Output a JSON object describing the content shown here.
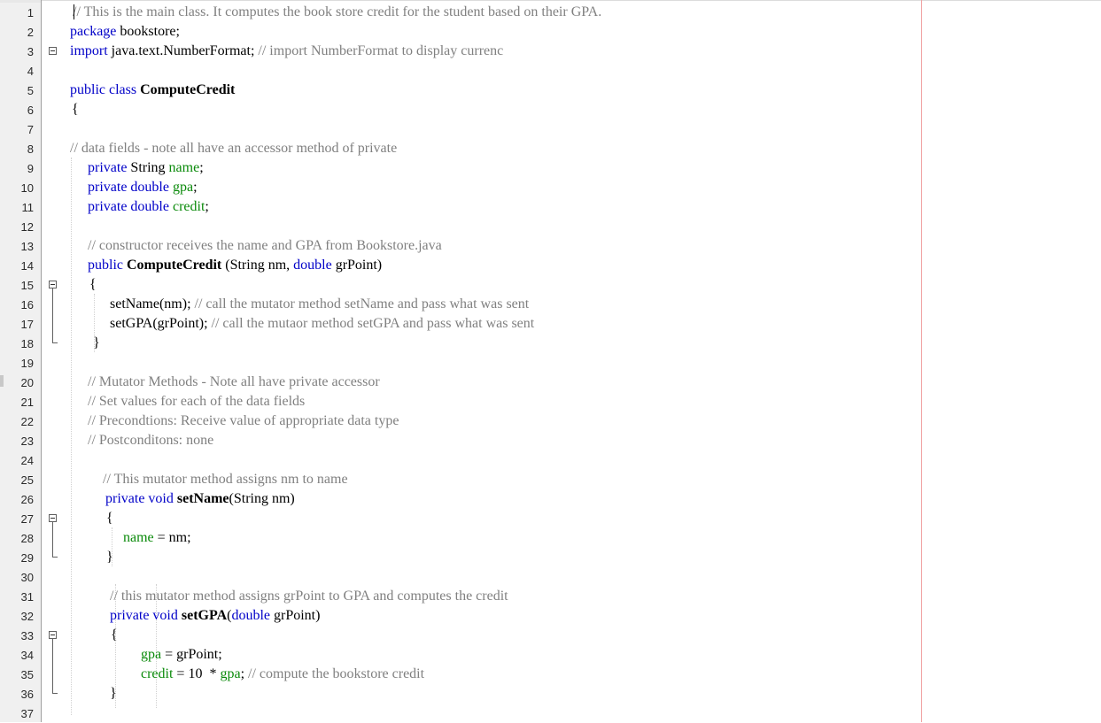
{
  "editor": {
    "lines": [
      {
        "n": "1",
        "tokens": [
          {
            "t": "// This is the main class. It computes the book store credit for the student based on their GPA.",
            "c": "cm"
          }
        ]
      },
      {
        "n": "2",
        "tokens": [
          {
            "t": "package",
            "c": "kw"
          },
          {
            "t": " bookstore;",
            "c": ""
          }
        ]
      },
      {
        "n": "3",
        "tokens": [
          {
            "t": "import",
            "c": "kw"
          },
          {
            "t": " java.text.NumberFormat; ",
            "c": ""
          },
          {
            "t": "// import NumberFormat to display currenc",
            "c": "cm"
          }
        ]
      },
      {
        "n": "4",
        "tokens": []
      },
      {
        "n": "5",
        "tokens": [
          {
            "t": "public",
            "c": "kw"
          },
          {
            "t": " ",
            "c": ""
          },
          {
            "t": "class",
            "c": "kw"
          },
          {
            "t": " ",
            "c": ""
          },
          {
            "t": "ComputeCredit",
            "c": "bold"
          }
        ]
      },
      {
        "n": "6",
        "tokens": [
          {
            "t": "{",
            "c": ""
          }
        ]
      },
      {
        "n": "7",
        "tokens": []
      },
      {
        "n": "8",
        "tokens": [
          {
            "t": "// data fields - note all have an accessor method of private",
            "c": "cm"
          }
        ]
      },
      {
        "n": "9",
        "tokens": [
          {
            "t": "private",
            "c": "kw"
          },
          {
            "t": " String ",
            "c": ""
          },
          {
            "t": "name",
            "c": "fld"
          },
          {
            "t": ";",
            "c": ""
          }
        ]
      },
      {
        "n": "10",
        "tokens": [
          {
            "t": "private",
            "c": "kw"
          },
          {
            "t": " ",
            "c": ""
          },
          {
            "t": "double",
            "c": "kw"
          },
          {
            "t": " ",
            "c": ""
          },
          {
            "t": "gpa",
            "c": "fld"
          },
          {
            "t": ";",
            "c": ""
          }
        ]
      },
      {
        "n": "11",
        "tokens": [
          {
            "t": "private",
            "c": "kw"
          },
          {
            "t": " ",
            "c": ""
          },
          {
            "t": "double",
            "c": "kw"
          },
          {
            "t": " ",
            "c": ""
          },
          {
            "t": "credit",
            "c": "fld"
          },
          {
            "t": ";",
            "c": ""
          }
        ]
      },
      {
        "n": "12",
        "tokens": []
      },
      {
        "n": "13",
        "tokens": [
          {
            "t": "// constructor receives the name and GPA from Bookstore.java",
            "c": "cm"
          }
        ]
      },
      {
        "n": "14",
        "tokens": [
          {
            "t": "public",
            "c": "kw"
          },
          {
            "t": " ",
            "c": ""
          },
          {
            "t": "ComputeCredit",
            "c": "bold"
          },
          {
            "t": " (String nm, ",
            "c": ""
          },
          {
            "t": "double",
            "c": "kw"
          },
          {
            "t": " grPoint)",
            "c": ""
          }
        ]
      },
      {
        "n": "15",
        "tokens": [
          {
            "t": "{",
            "c": ""
          }
        ]
      },
      {
        "n": "16",
        "tokens": [
          {
            "t": "setName(nm); ",
            "c": ""
          },
          {
            "t": "// call the mutator method setName and pass what was sent",
            "c": "cm"
          }
        ]
      },
      {
        "n": "17",
        "tokens": [
          {
            "t": "setGPA(grPoint); ",
            "c": ""
          },
          {
            "t": "// call the mutaor method setGPA and pass what was sent",
            "c": "cm"
          }
        ]
      },
      {
        "n": "18",
        "tokens": [
          {
            "t": "}",
            "c": ""
          }
        ]
      },
      {
        "n": "19",
        "tokens": []
      },
      {
        "n": "20",
        "tokens": [
          {
            "t": "// Mutator Methods - Note all have private accessor",
            "c": "cm"
          }
        ]
      },
      {
        "n": "21",
        "tokens": [
          {
            "t": "// Set values for each of the data fields",
            "c": "cm"
          }
        ]
      },
      {
        "n": "22",
        "tokens": [
          {
            "t": "// Precondtions: Receive value of appropriate data type",
            "c": "cm"
          }
        ]
      },
      {
        "n": "23",
        "tokens": [
          {
            "t": "// Postconditons: none",
            "c": "cm"
          }
        ]
      },
      {
        "n": "24",
        "tokens": []
      },
      {
        "n": "25",
        "tokens": [
          {
            "t": "// This mutator method assigns nm to name",
            "c": "cm"
          }
        ]
      },
      {
        "n": "26",
        "tokens": [
          {
            "t": "private",
            "c": "kw"
          },
          {
            "t": " ",
            "c": ""
          },
          {
            "t": "void",
            "c": "kw"
          },
          {
            "t": " ",
            "c": ""
          },
          {
            "t": "setName",
            "c": "bold"
          },
          {
            "t": "(String nm)",
            "c": ""
          }
        ]
      },
      {
        "n": "27",
        "tokens": [
          {
            "t": "{",
            "c": ""
          }
        ]
      },
      {
        "n": "28",
        "tokens": [
          {
            "t": "name",
            "c": "fld"
          },
          {
            "t": " = nm;",
            "c": ""
          }
        ]
      },
      {
        "n": "29",
        "tokens": [
          {
            "t": "}",
            "c": ""
          }
        ]
      },
      {
        "n": "30",
        "tokens": []
      },
      {
        "n": "31",
        "tokens": [
          {
            "t": "// this mutator method assigns grPoint to GPA and computes the credit",
            "c": "cm"
          }
        ]
      },
      {
        "n": "32",
        "tokens": [
          {
            "t": "private",
            "c": "kw"
          },
          {
            "t": " ",
            "c": ""
          },
          {
            "t": "void",
            "c": "kw"
          },
          {
            "t": " ",
            "c": ""
          },
          {
            "t": "setGPA",
            "c": "bold"
          },
          {
            "t": "(",
            "c": ""
          },
          {
            "t": "double",
            "c": "kw"
          },
          {
            "t": " grPoint)",
            "c": ""
          }
        ]
      },
      {
        "n": "33",
        "tokens": [
          {
            "t": "{",
            "c": ""
          }
        ]
      },
      {
        "n": "34",
        "tokens": [
          {
            "t": "gpa",
            "c": "fld"
          },
          {
            "t": " = grPoint;",
            "c": ""
          }
        ]
      },
      {
        "n": "35",
        "tokens": [
          {
            "t": "credit",
            "c": "fld"
          },
          {
            "t": " = 10  * ",
            "c": ""
          },
          {
            "t": "gpa",
            "c": "fld"
          },
          {
            "t": "; ",
            "c": ""
          },
          {
            "t": "// compute the bookstore credit",
            "c": "cm"
          }
        ]
      },
      {
        "n": "36",
        "tokens": [
          {
            "t": "}",
            "c": ""
          }
        ]
      },
      {
        "n": "37",
        "tokens": []
      }
    ]
  },
  "colors": {
    "keyword": "#0000c8",
    "field": "#0a8a0a",
    "comment": "#808080",
    "margin_line": "#f0a0a0"
  },
  "icons": [
    "fold-toggle-icon"
  ]
}
